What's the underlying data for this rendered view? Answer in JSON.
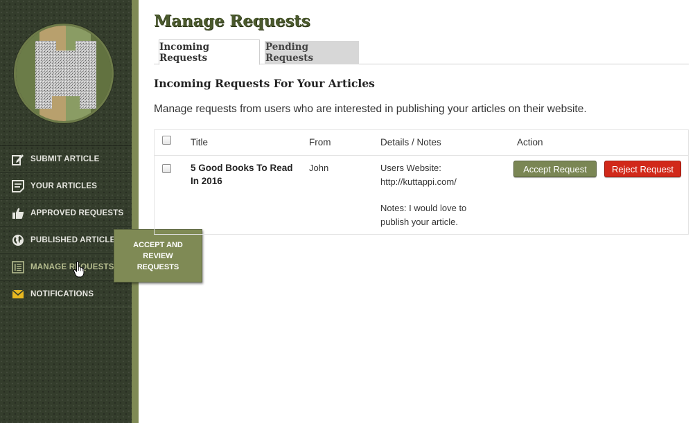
{
  "sidebar": {
    "items": [
      {
        "label": "SUBMIT ARTICLE",
        "icon": "edit-icon"
      },
      {
        "label": "YOUR ARTICLES",
        "icon": "document-icon"
      },
      {
        "label": "APPROVED REQUESTS",
        "icon": "thumbs-up-icon"
      },
      {
        "label": "PUBLISHED ARTICLES",
        "icon": "globe-icon"
      },
      {
        "label": "MANAGE REQUESTS",
        "icon": "list-icon",
        "active": true
      },
      {
        "label": "NOTIFICATIONS",
        "icon": "envelope-icon"
      }
    ],
    "tooltip": "ACCEPT AND REVIEW REQUESTS"
  },
  "main": {
    "title": "Manage Requests",
    "tabs": [
      {
        "label": "Incoming Requests",
        "active": true
      },
      {
        "label": "Pending Requests",
        "active": false
      }
    ],
    "section_title": "Incoming Requests For Your Articles",
    "description": "Manage requests from users who are interested in publishing your articles on their website.",
    "table": {
      "columns": [
        "Title",
        "From",
        "Details / Notes",
        "Action"
      ],
      "rows": [
        {
          "title": "5 Good Books To Read In 2016",
          "from": "John",
          "details_label": "Users Website:",
          "details_url": "http://kuttappi.com/",
          "notes": "Notes: I would love to publish your article.",
          "accept_label": "Accept Request",
          "reject_label": "Reject Request"
        }
      ]
    }
  },
  "colors": {
    "sidebar_bg": "#343d2c",
    "accent": "#7f8a55",
    "title": "#4b5a2d",
    "reject": "#d1291a"
  }
}
